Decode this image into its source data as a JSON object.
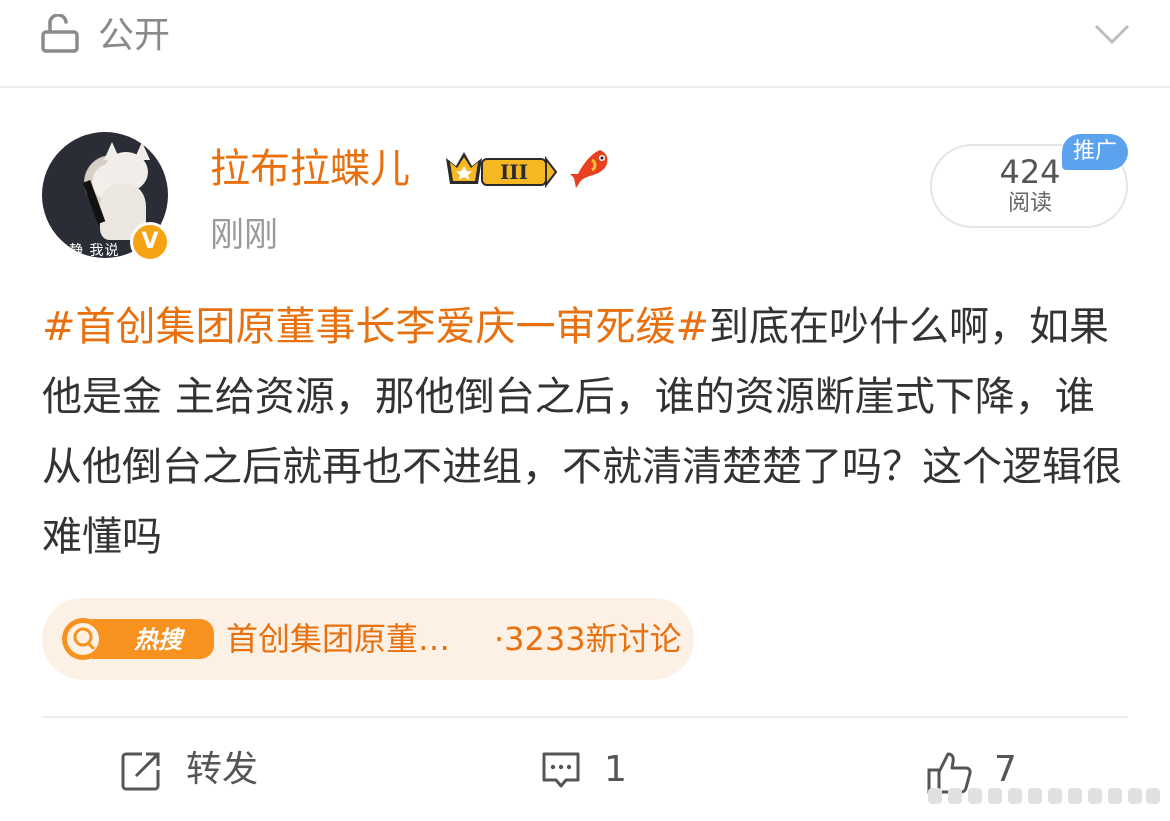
{
  "topbar": {
    "visibility": "公开"
  },
  "post": {
    "username": "拉布拉蝶儿",
    "level": "III",
    "timestamp": "刚刚",
    "read_count": "424",
    "read_label": "阅读",
    "promo_tag": "推广",
    "avatar_caption": "安静 我说",
    "topic": "#首创集团原董事长李爱庆一审死缓#",
    "body": "到底在吵什么啊，如果他是金 主给资源，那他倒台之后，谁的资源断崖式下降，谁从他倒台之后就再也不进组，不就清清楚楚了吗？这个逻辑很难懂吗"
  },
  "hot_search": {
    "logo_text": "热搜",
    "title": "首创集团原董…",
    "stat": "·3233新讨论"
  },
  "actions": {
    "repost": "转发",
    "comment": "1",
    "like": "7"
  },
  "colors": {
    "accent": "#e8700f",
    "promo": "#5ba2ef",
    "chip_bg": "#fdf1e5"
  }
}
